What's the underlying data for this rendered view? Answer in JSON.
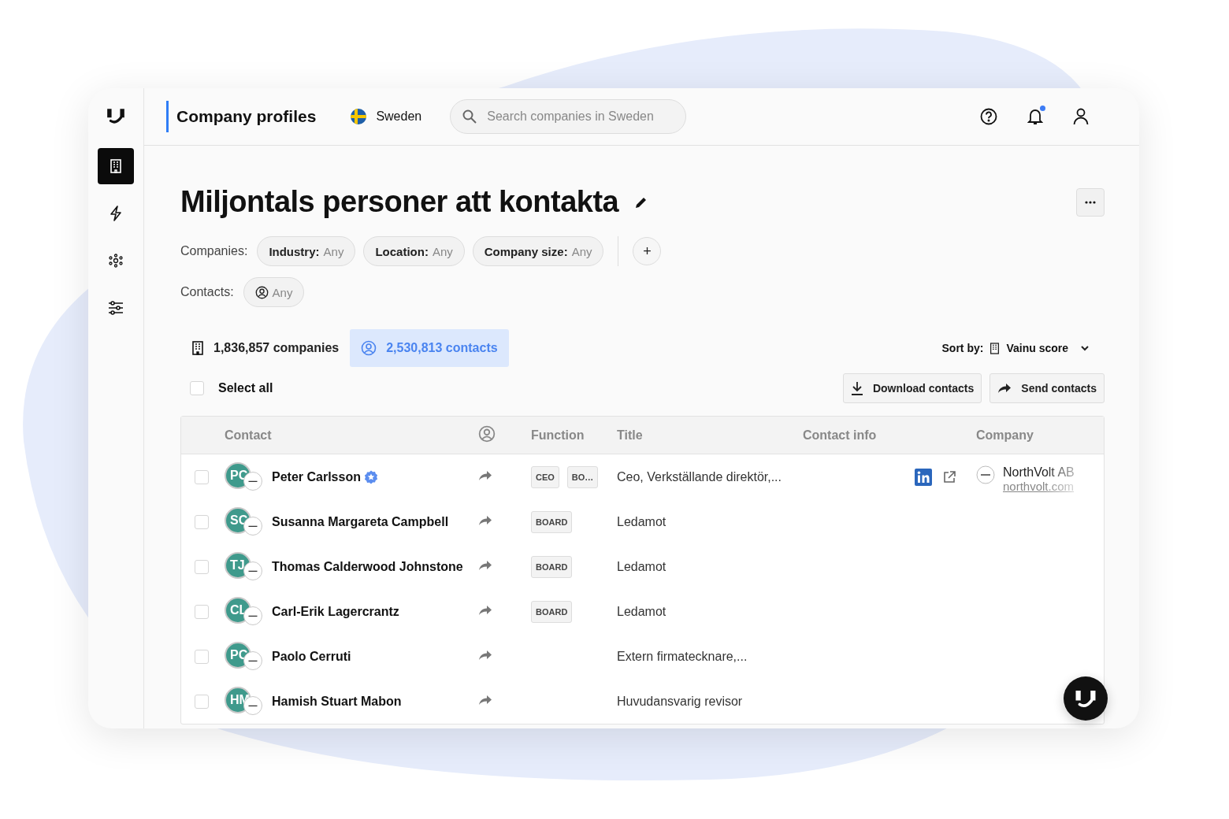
{
  "sidebar": {
    "items": [
      {
        "kind": "building",
        "selected": true
      },
      {
        "kind": "lightning",
        "selected": false
      },
      {
        "kind": "network",
        "selected": false
      },
      {
        "kind": "sliders",
        "selected": false
      }
    ]
  },
  "header": {
    "title": "Company profiles",
    "country": "Sweden",
    "search": {
      "placeholder": "Search companies in Sweden"
    },
    "notifications": {
      "unread": true
    }
  },
  "page": {
    "title": "Miljontals personer att kontakta",
    "company_filters_label": "Companies:",
    "company_filters": [
      {
        "label": "Industry:",
        "value": "Any"
      },
      {
        "label": "Location:",
        "value": "Any"
      },
      {
        "label": "Company size:",
        "value": "Any"
      }
    ],
    "add_filter": "+",
    "contact_filters_label": "Contacts:",
    "contact_filters": [
      {
        "value": "Any"
      }
    ]
  },
  "tabs": [
    {
      "kind": "companies",
      "label": "1,836,857 companies",
      "selected": false
    },
    {
      "kind": "contacts",
      "label": "2,530,813 contacts",
      "selected": true
    }
  ],
  "sort": {
    "label": "Sort by:",
    "value": "Vainu score"
  },
  "select_all": {
    "label": "Select all",
    "checked": false
  },
  "actions": [
    {
      "kind": "download",
      "label": "Download contacts"
    },
    {
      "kind": "send",
      "label": "Send contacts"
    }
  ],
  "table": {
    "columns": [
      {
        "kind": "text",
        "label": "Contact"
      },
      {
        "kind": "person-icon"
      },
      {
        "kind": "text",
        "label": "Function"
      },
      {
        "kind": "text",
        "label": "Title"
      },
      {
        "kind": "text",
        "label": "Contact info"
      },
      {
        "kind": "text",
        "label": "Company"
      }
    ],
    "rows": [
      {
        "checked": false,
        "initials": "PC",
        "name": "Peter Carlsson",
        "verified": true,
        "functions": [
          "CEO",
          "BO…"
        ],
        "title": "Ceo, Verkställande direktör,...",
        "linkedin": true,
        "company": {
          "name": "NorthVolt AB",
          "website": "northvolt.com"
        }
      },
      {
        "checked": false,
        "initials": "SC",
        "name": "Susanna Margareta Campbell",
        "verified": false,
        "functions": [
          "BOARD"
        ],
        "title": "Ledamot",
        "linkedin": false
      },
      {
        "checked": false,
        "initials": "TJ",
        "name": "Thomas Calderwood Johnstone",
        "verified": false,
        "functions": [
          "BOARD"
        ],
        "title": "Ledamot",
        "linkedin": false
      },
      {
        "checked": false,
        "initials": "CL",
        "name": "Carl-Erik Lagercrantz",
        "verified": false,
        "functions": [
          "BOARD"
        ],
        "title": "Ledamot",
        "linkedin": false
      },
      {
        "checked": false,
        "initials": "PC",
        "name": "Paolo Cerruti",
        "verified": false,
        "functions": [],
        "title": "Extern firmatecknare,...",
        "linkedin": false
      },
      {
        "checked": false,
        "initials": "HM",
        "name": "Hamish Stuart Mabon",
        "verified": false,
        "functions": [],
        "title": "Huvudansvarig revisor",
        "linkedin": false
      }
    ]
  }
}
